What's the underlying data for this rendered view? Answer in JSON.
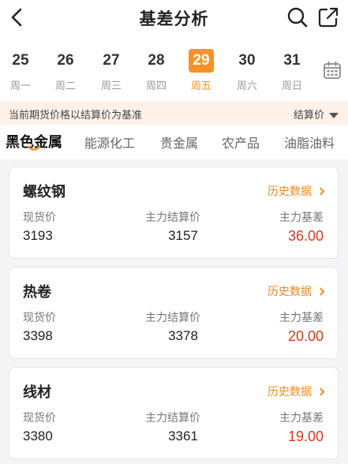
{
  "header": {
    "title": "基差分析",
    "icons": [
      "back-arrow-icon",
      "search-icon",
      "share-icon"
    ]
  },
  "dates": [
    {
      "day": "25",
      "weekday": "周一",
      "selected": false
    },
    {
      "day": "26",
      "weekday": "周二",
      "selected": false
    },
    {
      "day": "27",
      "weekday": "周三",
      "selected": false
    },
    {
      "day": "28",
      "weekday": "周四",
      "selected": false
    },
    {
      "day": "29",
      "weekday": "周五",
      "selected": true
    },
    {
      "day": "30",
      "weekday": "周六",
      "selected": false
    },
    {
      "day": "31",
      "weekday": "周日",
      "selected": false
    }
  ],
  "notice": {
    "text": "当前期货价格以结算价为基准",
    "price_basis": "结算价"
  },
  "tabs": [
    "黑色金属",
    "能源化工",
    "贵金属",
    "农产品",
    "油脂油料"
  ],
  "active_tab": "黑色金属",
  "cards": [
    {
      "name": "螺纹钢",
      "history_label": "历史数据",
      "spot_label": "现货价",
      "spot_value": "3193",
      "settle_label": "主力结算价",
      "settle_value": "3157",
      "basis_label": "主力基差",
      "basis_value": "36.00"
    },
    {
      "name": "热卷",
      "history_label": "历史数据",
      "spot_label": "现货价",
      "spot_value": "3398",
      "settle_label": "主力结算价",
      "settle_value": "3378",
      "basis_label": "主力基差",
      "basis_value": "20.00"
    },
    {
      "name": "线材",
      "history_label": "历史数据",
      "spot_label": "现货价",
      "spot_value": "3380",
      "settle_label": "主力结算价",
      "settle_value": "3361",
      "basis_label": "主力基差",
      "basis_value": "19.00"
    }
  ],
  "colors": {
    "accent": "#f7922a",
    "link": "#f08a24",
    "basis": "#d83a1e",
    "notice_bg": "#fdf1e8"
  }
}
